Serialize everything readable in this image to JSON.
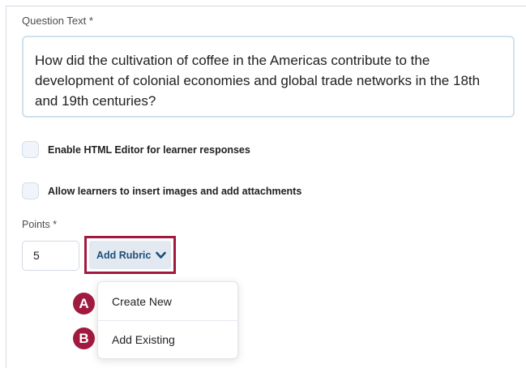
{
  "question": {
    "label": "Question Text *",
    "text": "How did the cultivation of coffee in the Americas contribute to the development of colonial economies and global trade networks in the 18th and 19th centuries?"
  },
  "options": [
    {
      "label": "Enable HTML Editor for learner responses",
      "checked": false
    },
    {
      "label": "Allow learners to insert images and add attachments",
      "checked": false
    }
  ],
  "points": {
    "label": "Points *",
    "value": "5"
  },
  "rubric_button": {
    "label": "Add Rubric",
    "icon": "chevron-down-icon"
  },
  "rubric_menu": {
    "items": [
      {
        "label": "Create New",
        "marker": "A"
      },
      {
        "label": "Add Existing",
        "marker": "B"
      }
    ]
  },
  "colors": {
    "highlight": "#a01a3f",
    "button_text": "#1d4f7c",
    "button_bg": "#e3e9f1"
  }
}
